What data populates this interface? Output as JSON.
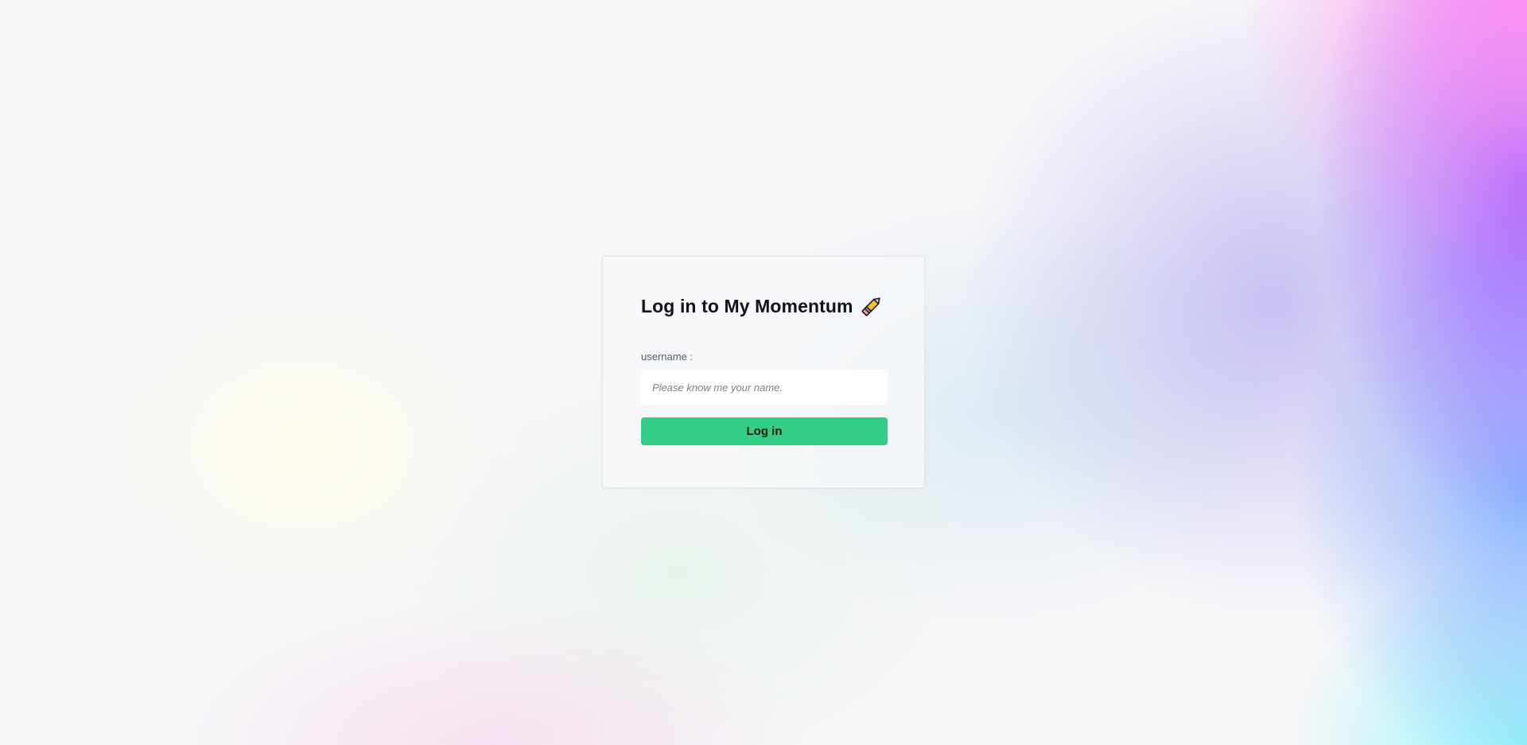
{
  "login": {
    "title": "Log in to My Momentum",
    "title_icon": "pencil-icon",
    "username_label": "username :",
    "username_value": "",
    "username_placeholder": "Please know me your name.",
    "submit_label": "Log in"
  },
  "colors": {
    "button": "#33ce86",
    "pencil_body": "#f5c12e",
    "pencil_tip": "#f59aa6"
  }
}
